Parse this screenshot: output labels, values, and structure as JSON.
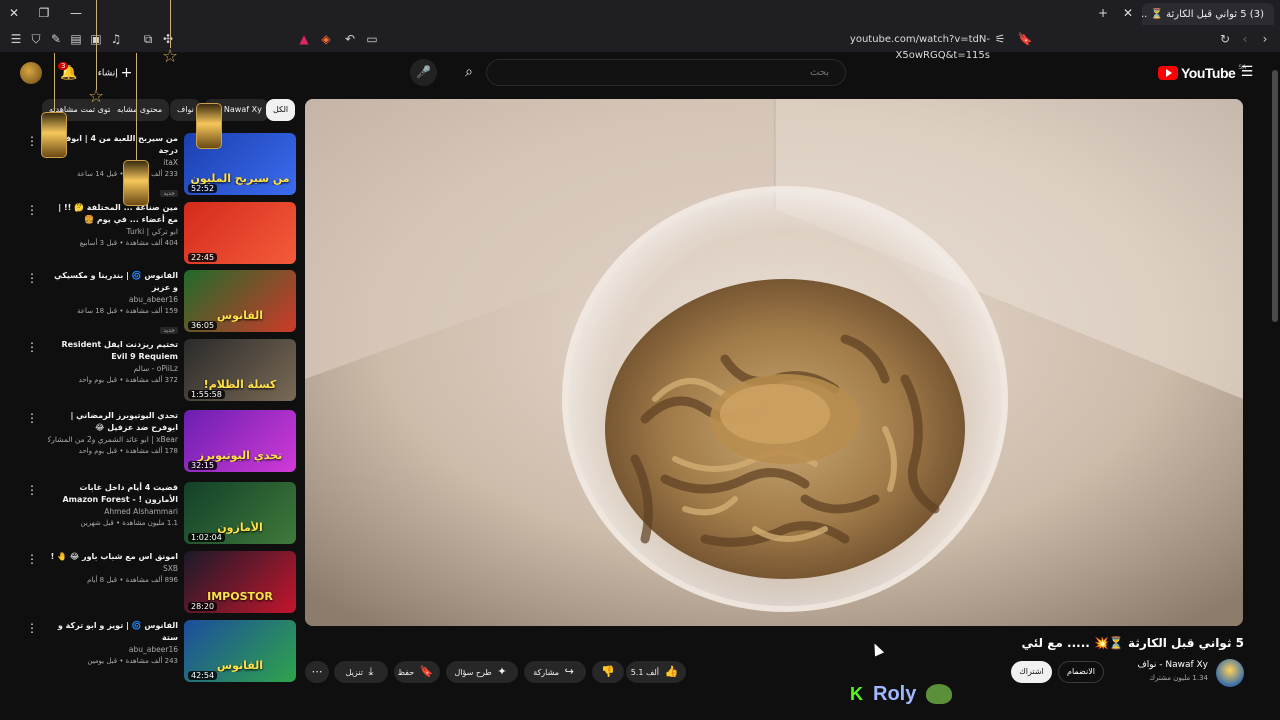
{
  "browser": {
    "active_tab_title": "(3) 5 ثواني قبل الكارثة ⏳ ...",
    "url": "youtube.com/watch?v=tdN-X5owRGQ&t=115s",
    "notification_count": "3"
  },
  "header": {
    "logo_text": "YouTube",
    "region": "SA",
    "search_placeholder": "بحث",
    "create_label": "إنشاء",
    "notification_badge": "3"
  },
  "chips": [
    "الكل",
    "من Nawaf Xy",
    "نواف",
    "محتوى مشابه",
    "محتوى تمت مشاهدته"
  ],
  "recommendations": [
    {
      "title": "من سيربح اللعبة من 4 | ابوفلة و درجة",
      "channel": "itaX",
      "views": "233 ألف مشاهدة • قبل 14 ساعة",
      "badge": "جديد",
      "duration": "52:52",
      "thumb_text": "من سيربح المليون",
      "thumb_colors": [
        "#1b3fae",
        "#3c6cf0"
      ]
    },
    {
      "title": "مين صناعة ... المختلفة 🤔 !! | مع أعضاء ... في يوم 🍔",
      "channel": "ابو تركي | Turki",
      "views": "404 ألف مشاهدة • قبل 3 أسابيع",
      "badge": "",
      "duration": "22:45",
      "thumb_text": "",
      "thumb_colors": [
        "#d42a1c",
        "#f45c3a"
      ]
    },
    {
      "title": "الفانوس 🌀 | بندرينا و مكسيكي و عزيز",
      "channel": "abu_abeer16",
      "views": "159 ألف مشاهدة • قبل 18 ساعة",
      "badge": "جديد",
      "duration": "36:05",
      "thumb_text": "الفانوس",
      "thumb_colors": [
        "#1f6b2a",
        "#cf3a2a"
      ]
    },
    {
      "title": "تختيم ريزدنت ايفل Resident Evil 9 Requiem",
      "channel": "oPiiLz - سالم",
      "views": "372 ألف مشاهدة • قبل يوم واحد",
      "badge": "",
      "duration": "1:55:58",
      "thumb_text": "كسلة الظلام!",
      "thumb_colors": [
        "#2a2a2a",
        "#7a6a55"
      ]
    },
    {
      "title": "تحدي اليوتيوبرز الرمضاني | ابوفرح ضد عزفيل 😂",
      "channel": "xBear | ابو عائد الشمري و2 من المشاركين الآخرين",
      "views": "178 ألف مشاهدة • قبل يوم واحد",
      "badge": "",
      "duration": "32:15",
      "thumb_text": "تحدي اليوتيوبرز",
      "thumb_colors": [
        "#6a1fb0",
        "#d23ad8"
      ]
    },
    {
      "title": "قضيت 4 أيام داخل غابات الأمازون ! - Amazon Forest",
      "channel": "Ahmed Alshammari",
      "views": "1.1 مليون مشاهدة • قبل شهرين",
      "badge": "",
      "duration": "1:02:04",
      "thumb_text": "الأمازون",
      "thumb_colors": [
        "#13402a",
        "#3f7a3a"
      ]
    },
    {
      "title": "امونق اس مع شباب باور 😂 🤚 !",
      "channel": "SXB",
      "views": "896 ألف مشاهدة • قبل 8 أيام",
      "badge": "",
      "duration": "28:20",
      "thumb_text": "IMPOSTOR",
      "thumb_colors": [
        "#1a1a2a",
        "#c4162c"
      ]
    },
    {
      "title": "الفانوس 🌀 | تويز و ابو تركة و ستة",
      "channel": "abu_abeer16",
      "views": "243 ألف مشاهدة • قبل يومين",
      "badge": "",
      "duration": "42:54",
      "thumb_text": "الفانوس",
      "thumb_colors": [
        "#1c4d9e",
        "#2fa44a"
      ]
    }
  ],
  "video": {
    "title": "5 ثواني قبل الكارثة ⏳💥 ..... مع لئي",
    "channel_name": "Nawaf Xy - نواف",
    "subscribers": "1.34 مليون مشترك",
    "join_label": "الانضمام",
    "subscribe_label": "اشتراك",
    "like_count": "5.1 ألف",
    "share_label": "مشاركة",
    "ask_label": "طرح سؤال",
    "save_label": "حفظ",
    "download_label": "تنزيل"
  },
  "overlay": {
    "kick_letter": "K",
    "streamer_name": "Roly"
  },
  "colors": {
    "background": "#0f0f0f",
    "brand_red": "#ff0000",
    "kick_green": "#53fc18"
  }
}
